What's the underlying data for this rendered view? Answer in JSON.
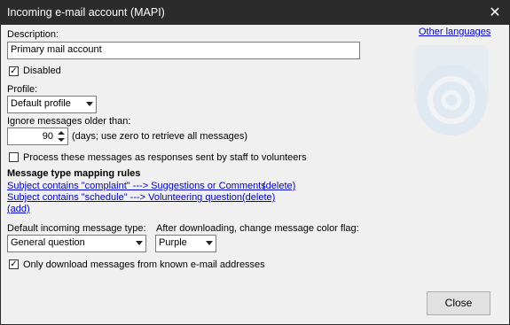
{
  "window": {
    "title": "Incoming e-mail account (MAPI)"
  },
  "links": {
    "other_languages": "Other languages"
  },
  "description": {
    "label": "Description:",
    "value": "Primary mail account"
  },
  "disabled": {
    "label": "Disabled",
    "checked": true
  },
  "profile": {
    "label": "Profile:",
    "value": "Default profile"
  },
  "ignore": {
    "label": "Ignore messages older than:",
    "value": "90",
    "hint": "(days; use zero to retrieve all messages)"
  },
  "process": {
    "label": "Process these messages as responses sent by staff to volunteers",
    "checked": false
  },
  "mapping": {
    "heading": "Message type mapping rules",
    "rules": [
      {
        "text": "Subject contains \"complaint\" ---> Suggestions or Comments",
        "delete": "(delete)"
      },
      {
        "text": "Subject contains \"schedule\" ---> Volunteering question",
        "delete": "(delete)"
      }
    ],
    "add": "(add)"
  },
  "default_type": {
    "label": "Default incoming message type:",
    "value": "General question"
  },
  "color_flag": {
    "label": "After downloading, change message color flag:",
    "value": "Purple"
  },
  "known_only": {
    "label": "Only download messages from known e-mail addresses",
    "checked": true
  },
  "buttons": {
    "close": "Close"
  },
  "icons": {
    "close": "close-icon",
    "check": "checkmark-icon",
    "watermark": "email-at-icon"
  }
}
